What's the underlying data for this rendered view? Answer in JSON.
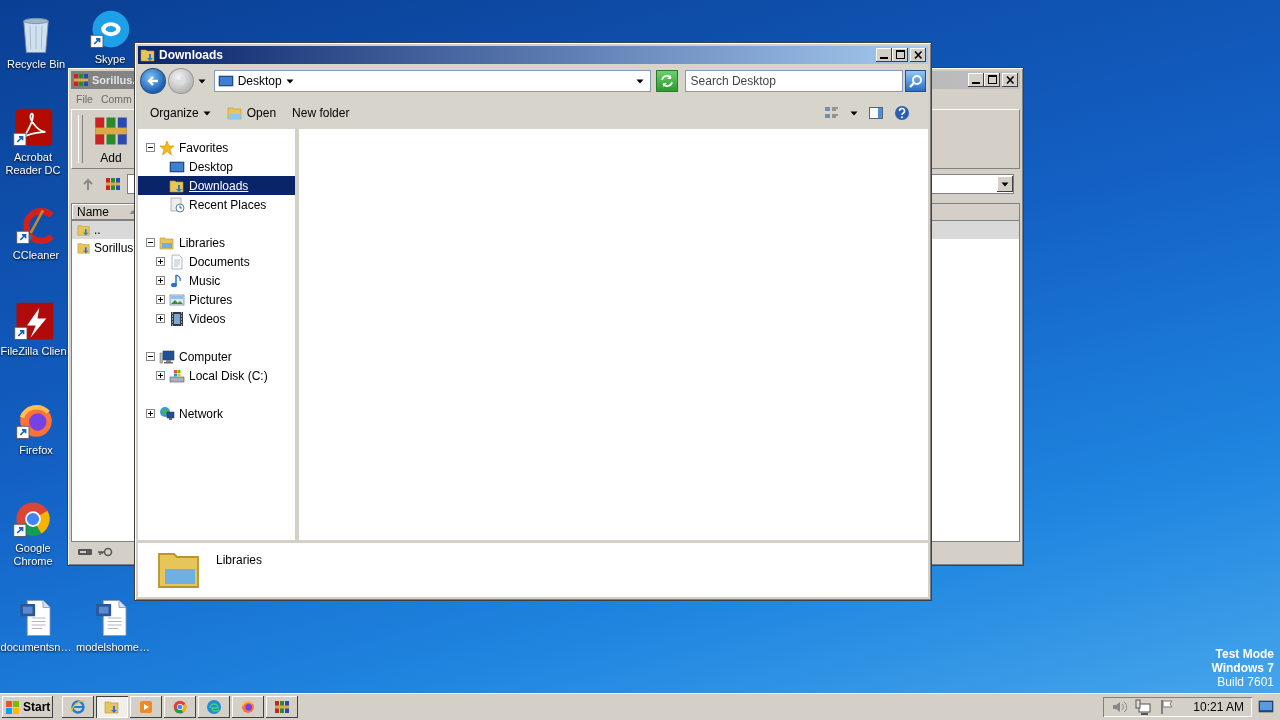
{
  "desktop_icons": [
    {
      "label": "Recycle Bin",
      "kind": "recycle-bin",
      "shortcut": false
    },
    {
      "label": "Skype",
      "kind": "skype",
      "shortcut": true
    },
    {
      "label": "Acrobat Reader DC",
      "kind": "acrobat",
      "shortcut": true
    },
    {
      "label": "CCleaner",
      "kind": "ccleaner",
      "shortcut": true
    },
    {
      "label": "FileZilla Clien",
      "kind": "filezilla",
      "shortcut": true
    },
    {
      "label": "Firefox",
      "kind": "firefox",
      "shortcut": true
    },
    {
      "label": "Google Chrome",
      "kind": "chrome",
      "shortcut": true
    },
    {
      "label": "documentsn…",
      "kind": "word-doc",
      "shortcut": false
    },
    {
      "label": "modelshome…",
      "kind": "word-doc",
      "shortcut": false
    }
  ],
  "back_window": {
    "title": "Sorillus.",
    "active": false,
    "menu": [
      "File",
      "Comm"
    ],
    "toolbar": [
      {
        "label": "Add",
        "kind": "winrar"
      }
    ],
    "columns": [
      {
        "label": "Name",
        "sorted": true
      }
    ],
    "rows": [
      {
        "name": "..",
        "selected": true
      },
      {
        "name": "Sorillus",
        "selected": false
      }
    ]
  },
  "explorer": {
    "title": "Downloads",
    "active": true,
    "back_enabled": true,
    "forward_enabled": false,
    "address": "Desktop",
    "search": {
      "placeholder": "Search Desktop"
    },
    "commands": [
      {
        "label": "Organize",
        "kind": "menu"
      },
      {
        "label": "Open",
        "kind": "open"
      },
      {
        "label": "New folder",
        "kind": "plain"
      }
    ],
    "tree": [
      {
        "label": "Favorites",
        "kind": "star",
        "expanded": true,
        "selected": false,
        "children": [
          {
            "label": "Desktop",
            "kind": "desktop",
            "selected": false
          },
          {
            "label": "Downloads",
            "kind": "downloads",
            "selected": true
          },
          {
            "label": "Recent Places",
            "kind": "recent",
            "selected": false
          }
        ]
      },
      {
        "label": "Libraries",
        "kind": "library",
        "expanded": true,
        "selected": false,
        "children": [
          {
            "label": "Documents",
            "kind": "document",
            "expanded": false,
            "selected": false
          },
          {
            "label": "Music",
            "kind": "music",
            "expanded": false,
            "selected": false
          },
          {
            "label": "Pictures",
            "kind": "pictures",
            "expanded": false,
            "selected": false
          },
          {
            "label": "Videos",
            "kind": "videos",
            "expanded": false,
            "selected": false
          }
        ]
      },
      {
        "label": "Computer",
        "kind": "computer",
        "expanded": true,
        "selected": false,
        "children": [
          {
            "label": "Local Disk (C:)",
            "kind": "disk",
            "expanded": false,
            "selected": false
          }
        ]
      },
      {
        "label": "Network",
        "kind": "network",
        "expanded": false,
        "selected": false
      }
    ],
    "details": {
      "label": "Libraries",
      "kind": "library"
    }
  },
  "taskbar": {
    "start": "Start",
    "apps": [
      {
        "kind": "ie",
        "active": false
      },
      {
        "kind": "downloads",
        "active": true
      },
      {
        "kind": "media",
        "active": false
      },
      {
        "kind": "chrome",
        "active": false
      },
      {
        "kind": "edge",
        "active": false
      },
      {
        "kind": "firefox",
        "active": false
      },
      {
        "kind": "winrar",
        "active": false
      }
    ],
    "clock": "10:21 AM"
  },
  "os_info": [
    "Test Mode",
    "Windows 7",
    "Build 7601"
  ]
}
